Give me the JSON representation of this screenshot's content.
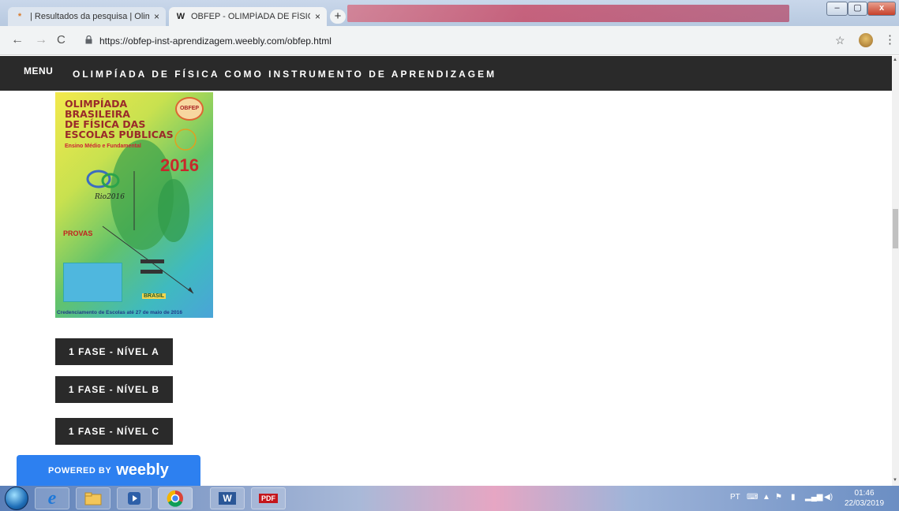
{
  "browser": {
    "tabs": [
      {
        "title": "| Resultados da pesquisa | Olimp",
        "close": "×",
        "favicon": "*"
      },
      {
        "title": "OBFEP - OLIMPÍADA DE FÍSICA C",
        "close": "×",
        "favicon": "W"
      }
    ],
    "new_tab": "+",
    "window_controls": {
      "minimize": "–",
      "maximize": "▢",
      "close": "x"
    },
    "nav": {
      "back": "←",
      "forward": "→",
      "reload": "C"
    },
    "url": "https://obfep-inst-aprendizagem.weebly.com/obfep.html",
    "bookmark": "☆",
    "menu": "⋮"
  },
  "site": {
    "menu_label": "MENU",
    "title": "OLIMPÍADA DE FÍSICA COMO INSTRUMENTO DE APRENDIZAGEM",
    "poster": {
      "title": "OLIMPÍADA\nBRASILEIRA\nDE FÍSICA DAS\nESCOLAS PÚBLICAS",
      "subtitle": "Ensino Médio e Fundamental",
      "year": "2016",
      "rio": "Rio2016",
      "badge": "OBFEP",
      "provas": "PROVAS",
      "brasil": "BRASIL",
      "credenciamento": "Credenciamento de Escolas até 27 de maio de 2016"
    },
    "buttons": [
      "1 FASE - NÍVEL A",
      "1 FASE - NÍVEL B",
      "1 FASE - NÍVEL C"
    ],
    "weebly": {
      "powered_by": "POWERED BY",
      "brand": "weebly"
    }
  },
  "taskbar": {
    "apps": [
      "e",
      "W",
      "PDF"
    ],
    "tray_lang": "PT",
    "time": "01:46",
    "date": "22/03/2019"
  }
}
